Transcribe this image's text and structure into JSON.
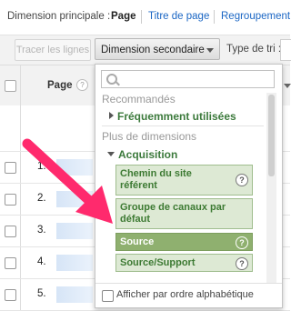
{
  "topbar": {
    "label": "Dimension principale :",
    "active": "Page",
    "link1": "Titre de page",
    "link2": "Regroupement de"
  },
  "toolbar": {
    "trace_button": "Tracer les lignes",
    "secondary_dimension": "Dimension secondaire",
    "sort_label": "Type de tri :"
  },
  "table": {
    "header_page": "Page",
    "rows": [
      "1.",
      "2.",
      "3.",
      "4.",
      "5."
    ]
  },
  "dropdown": {
    "search_placeholder": "",
    "recommended_label": "Recommandés",
    "frequent_label": "Fréquemment utilisées",
    "other_dims_label": "Plus de dimensions",
    "acquisition_label": "Acquisition",
    "items": [
      {
        "label": "Chemin du site référent",
        "selected": false
      },
      {
        "label": "Groupe de canaux par défaut",
        "selected": false
      },
      {
        "label": "Source",
        "selected": true
      },
      {
        "label": "Source/Support",
        "selected": false
      }
    ],
    "alpha_sort_label": "Afficher par ordre alphabétique"
  },
  "colors": {
    "link": "#1a66c4",
    "group_green": "#3c7a3c",
    "item_bg": "#dde9d4",
    "item_selected_bg": "#8fb06f",
    "arrow": "#ff2a6d"
  }
}
